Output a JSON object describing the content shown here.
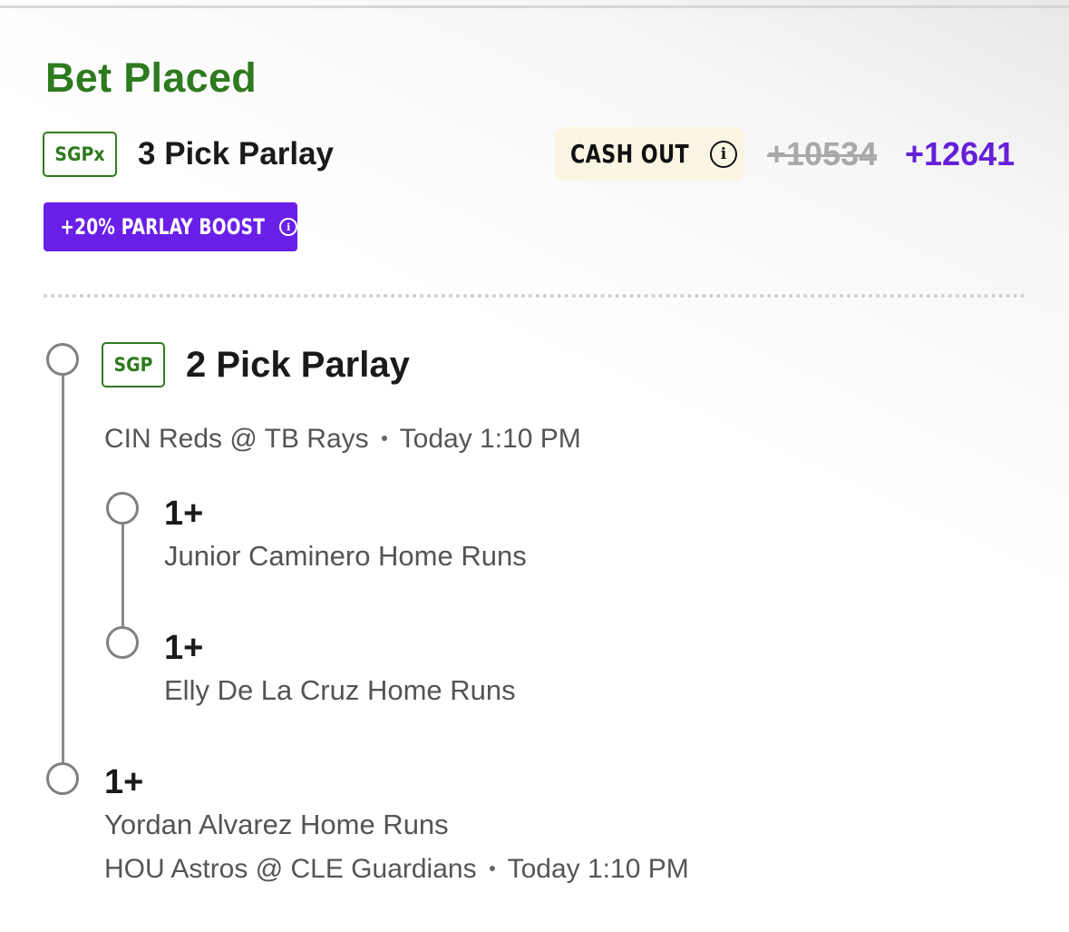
{
  "bet": {
    "status": "Bet Placed",
    "badge": "SGPx",
    "title": "3 Pick Parlay",
    "cash_out_label": "CASH OUT",
    "original_odds": "+10534",
    "boosted_odds": "+12641",
    "boost_label": "+20% PARLAY BOOST",
    "colors": {
      "status": "#2e7a1f",
      "boost": "#6a1fe8",
      "odds": "#6420d8"
    }
  },
  "legs": [
    {
      "badge": "SGP",
      "title": "2 Pick Parlay",
      "game": {
        "teams": "CIN Reds @ TB Rays",
        "time": "Today 1:10 PM"
      },
      "picks": [
        {
          "value": "1+",
          "desc": "Junior Caminero Home Runs"
        },
        {
          "value": "1+",
          "desc": "Elly De La Cruz Home Runs"
        }
      ]
    },
    {
      "value": "1+",
      "desc": "Yordan Alvarez Home Runs",
      "game": {
        "teams": "HOU Astros @ CLE Guardians",
        "time": "Today 1:10 PM"
      }
    }
  ]
}
